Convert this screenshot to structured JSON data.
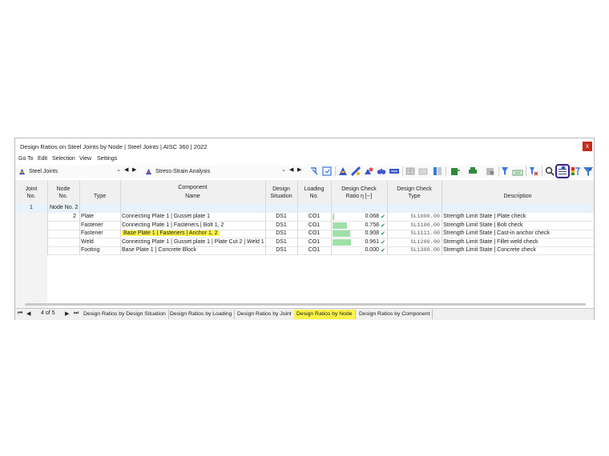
{
  "window": {
    "title": "Design Ratios on Steel Joints by Node | Steel Joints | AISC 360 | 2022",
    "close_label": "x"
  },
  "menu": [
    "Go To",
    "Edit",
    "Selection",
    "View",
    "Settings"
  ],
  "toolbar": {
    "module_combo": "Steel Joints",
    "result_combo": "Stress-Strain Analysis",
    "highlighted_button": "info-icon",
    "more_label": "»"
  },
  "table": {
    "headers": {
      "joint": [
        "Joint",
        "No."
      ],
      "node": [
        "Node",
        "No."
      ],
      "type": [
        "",
        "Type"
      ],
      "component_top": "Component",
      "component_name": "Name",
      "design_situation": [
        "Design",
        "Situation"
      ],
      "loading": [
        "Loading",
        "No."
      ],
      "ratio": [
        "Design Check",
        "Ratio η [--]"
      ],
      "check_type": [
        "Design Check",
        "Type"
      ],
      "description": [
        "",
        "Description"
      ]
    },
    "group": {
      "joint_no": "1",
      "label": "Node No. 2"
    },
    "rows": [
      {
        "node": "2",
        "type": "Plate",
        "name": "Connecting Plate 1 | Gusset plate 1",
        "situation": "DS1",
        "loading": "CO1",
        "ratio": 0.068,
        "ratio_text": "0.068",
        "check_type": "SL1000.00",
        "description": "Strength Limit State | Plate check",
        "highlight": false
      },
      {
        "node": "",
        "type": "Fastener",
        "name": "Connecting Plate 1 | Fasteners | Bolt 1, 2",
        "situation": "DS1",
        "loading": "CO1",
        "ratio": 0.758,
        "ratio_text": "0.758",
        "check_type": "SL1100.00",
        "description": "Strength Limit State | Bolt check",
        "highlight": false
      },
      {
        "node": "",
        "type": "Fastener",
        "name": "Base Plate 1 | Fasteners | Anchor 1, 2",
        "situation": "DS1",
        "loading": "CO1",
        "ratio": 0.908,
        "ratio_text": "0.908",
        "check_type": "SL1111.00",
        "description": "Strength Limit State | Cast-in anchor check",
        "highlight": true
      },
      {
        "node": "",
        "type": "Weld",
        "name": "Connecting Plate 1 | Gusset plate 1 | Plate Cut 2 | Weld 1",
        "situation": "DS1",
        "loading": "CO1",
        "ratio": 0.961,
        "ratio_text": "0.961",
        "check_type": "SL1200.00",
        "description": "Strength Limit State | Fillet weld check",
        "highlight": false
      },
      {
        "node": "",
        "type": "Footing",
        "name": "Base Plate 1 | Concrete Block",
        "situation": "DS1",
        "loading": "CO1",
        "ratio": 0.0,
        "ratio_text": "0.000",
        "check_type": "SL1300.00",
        "description": "Strength Limit State | Concrete check",
        "highlight": false
      }
    ],
    "check_mark": "✔"
  },
  "pager": {
    "text": "4 of 5"
  },
  "tabs": [
    {
      "label": "Design Ratios by Design Situation",
      "active": false
    },
    {
      "label": "Design Ratios by Loading",
      "active": false
    },
    {
      "label": "Design Ratios by Joint",
      "active": false
    },
    {
      "label": "Design Ratios by Node",
      "active": true
    },
    {
      "label": "Design Ratios by Component",
      "active": false
    }
  ],
  "colors": {
    "highlight": "#fbf34a",
    "ratio_bar": "#9fe0a8",
    "check": "#2e8b3c",
    "close": "#c42b1c",
    "selected_outline": "#3d1f8f",
    "group_row": "#e8f2fb"
  }
}
